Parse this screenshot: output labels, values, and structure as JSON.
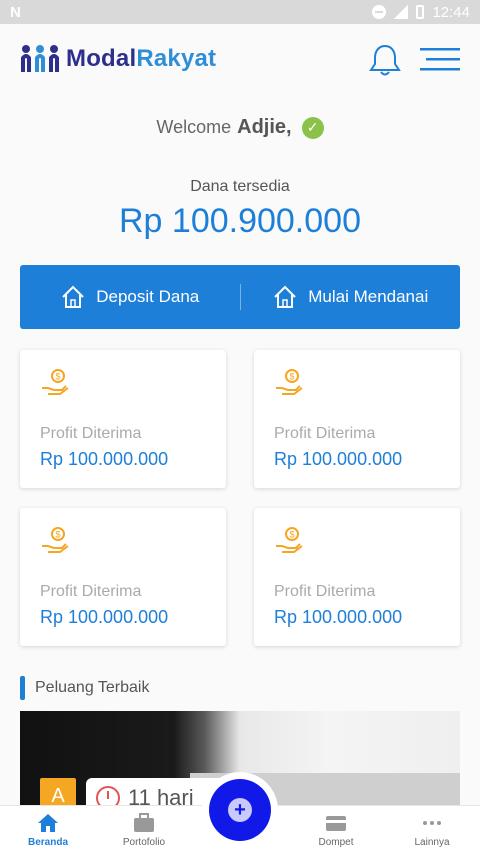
{
  "status_bar": {
    "left_icon": "n-icon",
    "time": "12:44"
  },
  "app": {
    "logo_part1": "Modal",
    "logo_part2": "Rakyat",
    "brand_color": "#2e2f8c",
    "accent_color": "#1e7fd8"
  },
  "welcome": {
    "prefix": "Welcome",
    "name": "Adjie,"
  },
  "balance": {
    "label": "Dana tersedia",
    "value": "Rp 100.900.000"
  },
  "actions": [
    {
      "label": "Deposit Dana",
      "icon": "home-icon"
    },
    {
      "label": "Mulai Mendanai",
      "icon": "home-icon"
    }
  ],
  "cards": [
    {
      "label": "Profit Diterima",
      "value": "Rp 100.000.000",
      "icon": "money-hand-icon"
    },
    {
      "label": "Profit Diterima",
      "value": "Rp 100.000.000",
      "icon": "money-hand-icon"
    },
    {
      "label": "Profit Diterima",
      "value": "Rp 100.000.000",
      "icon": "money-hand-icon"
    },
    {
      "label": "Profit Diterima",
      "value": "Rp 100.000.000",
      "icon": "money-hand-icon"
    }
  ],
  "section": {
    "title": "Peluang Terbaik"
  },
  "opportunity": {
    "badge": "A",
    "days": "11 hari"
  },
  "nav": [
    {
      "label": "Beranda",
      "icon": "home-icon",
      "active": true
    },
    {
      "label": "Portofolio",
      "icon": "briefcase-icon"
    },
    {
      "label": "Dompet",
      "icon": "wallet-icon"
    },
    {
      "label": "Lainnya",
      "icon": "more-icon"
    }
  ],
  "fab": {
    "symbol": "+"
  }
}
